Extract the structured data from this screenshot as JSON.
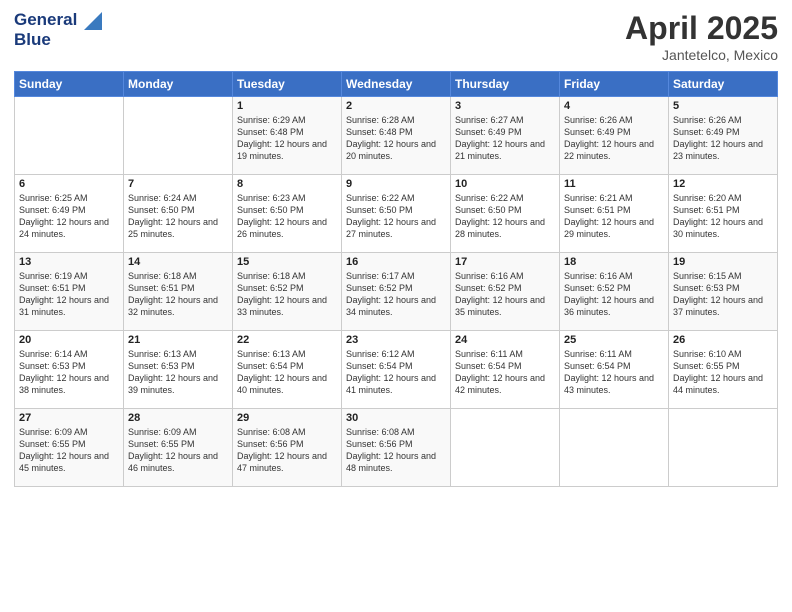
{
  "logo": {
    "line1": "General",
    "line2": "Blue"
  },
  "title": "April 2025",
  "subtitle": "Jantetelco, Mexico",
  "weekdays": [
    "Sunday",
    "Monday",
    "Tuesday",
    "Wednesday",
    "Thursday",
    "Friday",
    "Saturday"
  ],
  "weeks": [
    [
      null,
      null,
      {
        "day": 1,
        "sunrise": "6:29 AM",
        "sunset": "6:48 PM",
        "daylight": "12 hours and 19 minutes."
      },
      {
        "day": 2,
        "sunrise": "6:28 AM",
        "sunset": "6:48 PM",
        "daylight": "12 hours and 20 minutes."
      },
      {
        "day": 3,
        "sunrise": "6:27 AM",
        "sunset": "6:49 PM",
        "daylight": "12 hours and 21 minutes."
      },
      {
        "day": 4,
        "sunrise": "6:26 AM",
        "sunset": "6:49 PM",
        "daylight": "12 hours and 22 minutes."
      },
      {
        "day": 5,
        "sunrise": "6:26 AM",
        "sunset": "6:49 PM",
        "daylight": "12 hours and 23 minutes."
      }
    ],
    [
      {
        "day": 6,
        "sunrise": "6:25 AM",
        "sunset": "6:49 PM",
        "daylight": "12 hours and 24 minutes."
      },
      {
        "day": 7,
        "sunrise": "6:24 AM",
        "sunset": "6:50 PM",
        "daylight": "12 hours and 25 minutes."
      },
      {
        "day": 8,
        "sunrise": "6:23 AM",
        "sunset": "6:50 PM",
        "daylight": "12 hours and 26 minutes."
      },
      {
        "day": 9,
        "sunrise": "6:22 AM",
        "sunset": "6:50 PM",
        "daylight": "12 hours and 27 minutes."
      },
      {
        "day": 10,
        "sunrise": "6:22 AM",
        "sunset": "6:50 PM",
        "daylight": "12 hours and 28 minutes."
      },
      {
        "day": 11,
        "sunrise": "6:21 AM",
        "sunset": "6:51 PM",
        "daylight": "12 hours and 29 minutes."
      },
      {
        "day": 12,
        "sunrise": "6:20 AM",
        "sunset": "6:51 PM",
        "daylight": "12 hours and 30 minutes."
      }
    ],
    [
      {
        "day": 13,
        "sunrise": "6:19 AM",
        "sunset": "6:51 PM",
        "daylight": "12 hours and 31 minutes."
      },
      {
        "day": 14,
        "sunrise": "6:18 AM",
        "sunset": "6:51 PM",
        "daylight": "12 hours and 32 minutes."
      },
      {
        "day": 15,
        "sunrise": "6:18 AM",
        "sunset": "6:52 PM",
        "daylight": "12 hours and 33 minutes."
      },
      {
        "day": 16,
        "sunrise": "6:17 AM",
        "sunset": "6:52 PM",
        "daylight": "12 hours and 34 minutes."
      },
      {
        "day": 17,
        "sunrise": "6:16 AM",
        "sunset": "6:52 PM",
        "daylight": "12 hours and 35 minutes."
      },
      {
        "day": 18,
        "sunrise": "6:16 AM",
        "sunset": "6:52 PM",
        "daylight": "12 hours and 36 minutes."
      },
      {
        "day": 19,
        "sunrise": "6:15 AM",
        "sunset": "6:53 PM",
        "daylight": "12 hours and 37 minutes."
      }
    ],
    [
      {
        "day": 20,
        "sunrise": "6:14 AM",
        "sunset": "6:53 PM",
        "daylight": "12 hours and 38 minutes."
      },
      {
        "day": 21,
        "sunrise": "6:13 AM",
        "sunset": "6:53 PM",
        "daylight": "12 hours and 39 minutes."
      },
      {
        "day": 22,
        "sunrise": "6:13 AM",
        "sunset": "6:54 PM",
        "daylight": "12 hours and 40 minutes."
      },
      {
        "day": 23,
        "sunrise": "6:12 AM",
        "sunset": "6:54 PM",
        "daylight": "12 hours and 41 minutes."
      },
      {
        "day": 24,
        "sunrise": "6:11 AM",
        "sunset": "6:54 PM",
        "daylight": "12 hours and 42 minutes."
      },
      {
        "day": 25,
        "sunrise": "6:11 AM",
        "sunset": "6:54 PM",
        "daylight": "12 hours and 43 minutes."
      },
      {
        "day": 26,
        "sunrise": "6:10 AM",
        "sunset": "6:55 PM",
        "daylight": "12 hours and 44 minutes."
      }
    ],
    [
      {
        "day": 27,
        "sunrise": "6:09 AM",
        "sunset": "6:55 PM",
        "daylight": "12 hours and 45 minutes."
      },
      {
        "day": 28,
        "sunrise": "6:09 AM",
        "sunset": "6:55 PM",
        "daylight": "12 hours and 46 minutes."
      },
      {
        "day": 29,
        "sunrise": "6:08 AM",
        "sunset": "6:56 PM",
        "daylight": "12 hours and 47 minutes."
      },
      {
        "day": 30,
        "sunrise": "6:08 AM",
        "sunset": "6:56 PM",
        "daylight": "12 hours and 48 minutes."
      },
      null,
      null,
      null
    ]
  ]
}
